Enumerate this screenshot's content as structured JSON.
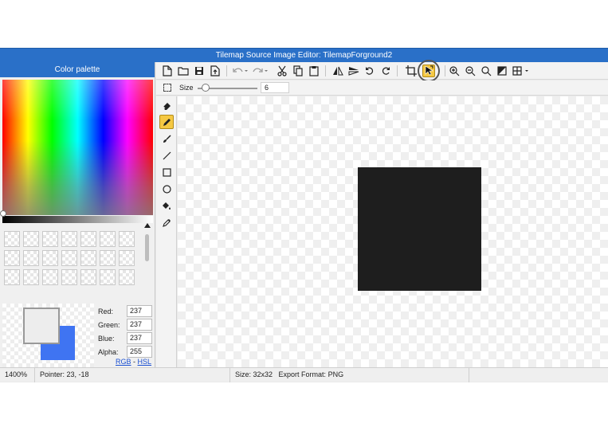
{
  "window": {
    "title": "Tilemap Source Image Editor: TilemapForground2"
  },
  "palette": {
    "header": "Color palette",
    "foreground": {
      "hex": "#EDEDED"
    },
    "background": {
      "hex": "#3F74F2"
    },
    "channels": [
      {
        "label": "Red:",
        "value": "237"
      },
      {
        "label": "Green:",
        "value": "237"
      },
      {
        "label": "Blue:",
        "value": "237"
      },
      {
        "label": "Alpha:",
        "value": "255"
      }
    ],
    "links": {
      "rgb": "RGB",
      "separator": " - ",
      "hsl": "HSL"
    }
  },
  "toolbar": {
    "icons": [
      "new-file-icon",
      "open-folder-icon",
      "save-icon",
      "export-icon",
      "undo-icon",
      "redo-icon",
      "cut-icon",
      "copy-icon",
      "paste-icon",
      "flip-horizontal-icon",
      "flip-vertical-icon",
      "rotate-left-icon",
      "rotate-right-icon",
      "crop-icon",
      "select-pointer-icon",
      "zoom-in-icon",
      "zoom-out-icon",
      "zoom-fit-icon",
      "invert-icon",
      "grid-icon"
    ],
    "active": "select-pointer-icon"
  },
  "options": {
    "size_label": "Size",
    "size_value": "6",
    "slider_fraction": 0.06
  },
  "tools": [
    "eraser-icon",
    "pencil-icon",
    "brush-icon",
    "line-icon",
    "rectangle-icon",
    "ellipse-icon",
    "fill-bucket-icon",
    "eyedropper-icon"
  ],
  "active_tool": "pencil-icon",
  "canvas": {
    "fill_color": "#1E1E1E"
  },
  "status": {
    "zoom": "1400%",
    "pointer": "Pointer: 23, -18",
    "size": "Size: 32x32",
    "format": "Export Format: PNG"
  }
}
